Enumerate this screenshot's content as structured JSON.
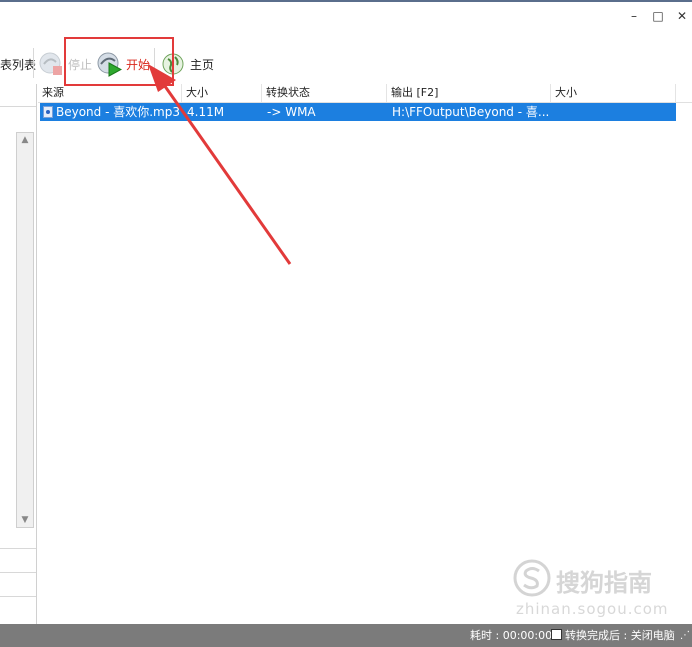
{
  "window": {
    "minimize_glyph": "–",
    "maximize_glyph": "□",
    "close_glyph": "✕"
  },
  "toolbar": {
    "list_label": "表列表",
    "stop_label": "停止",
    "start_label": "开始",
    "home_label": "主页"
  },
  "table": {
    "headers": [
      "来源",
      "大小",
      "转换状态",
      "输出 [F2]",
      "大小"
    ],
    "rows": [
      {
        "source": "Beyond - 喜欢你.mp3",
        "size": "4.11M",
        "status": "-> WMA",
        "output": "H:\\FFOutput\\Beyond - 喜...",
        "out_size": ""
      }
    ]
  },
  "statusbar": {
    "elapsed": "耗时 : 00:00:00",
    "after_done": "转换完成后 : 关闭电脑"
  },
  "colors": {
    "selection": "#1c7fe0",
    "annotation": "#e23a3a",
    "start_text": "#d9271c"
  },
  "watermark": {
    "brand": "搜狗指南",
    "url": "zhinan.sogou.com"
  }
}
